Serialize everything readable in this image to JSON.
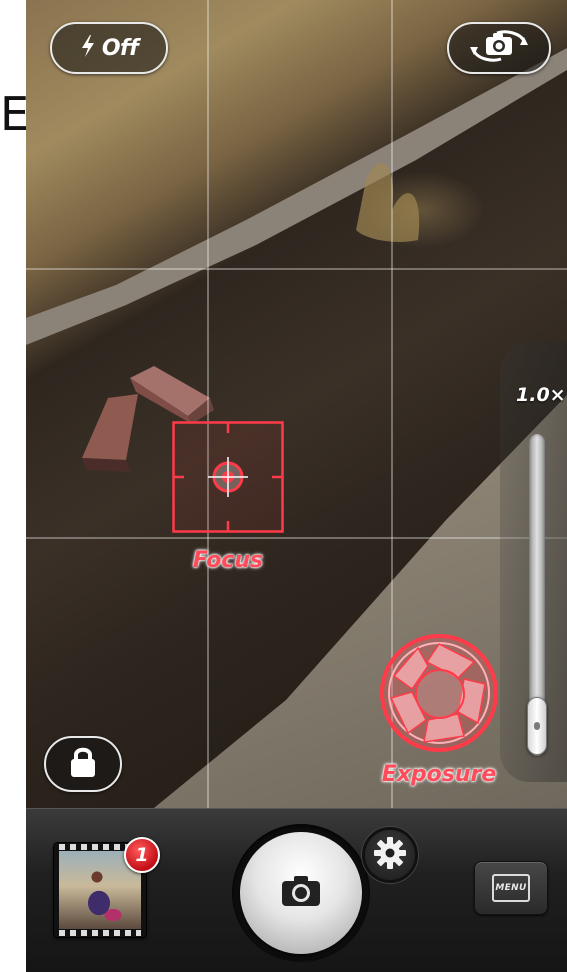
{
  "margin_text": "E",
  "flash": {
    "label": "Off",
    "icon": "lightning-bolt-icon"
  },
  "flip_camera": {
    "icon": "switch-camera-icon"
  },
  "focus": {
    "label": "Focus",
    "icon": "crosshair-target-icon"
  },
  "exposure": {
    "label": "Exposure",
    "icon": "aperture-icon"
  },
  "zoom": {
    "value": "1.0×",
    "level": 0.0
  },
  "lock": {
    "icon": "lock-icon"
  },
  "toolbar": {
    "camera_roll": {
      "badge_count": "1",
      "icon": "photo-thumbnail"
    },
    "shutter": {
      "icon": "camera-icon"
    },
    "settings": {
      "icon": "gear-icon"
    },
    "menu": {
      "label": "MENU",
      "icon": "menu-icon"
    }
  },
  "colors": {
    "accent_red": "#ff4b5a",
    "badge_red": "#c30e17",
    "toolbar_bg": "#202020",
    "pill_border": "#e9e9e9"
  }
}
